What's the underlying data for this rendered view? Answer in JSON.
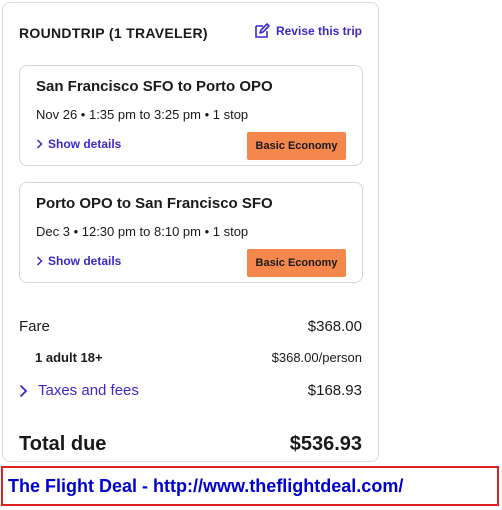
{
  "summary": {
    "title": "ROUNDTRIP (1 TRAVELER)",
    "revise_label": "Revise this trip"
  },
  "flights": [
    {
      "route": "San Francisco SFO to Porto OPO",
      "times": "Nov 26 • 1:35 pm to 3:25 pm • 1 stop",
      "details_label": "Show details",
      "fare_class": "Basic Economy"
    },
    {
      "route": "Porto OPO to San Francisco SFO",
      "times": "Dec 3 • 12:30 pm to 8:10 pm • 1 stop",
      "details_label": "Show details",
      "fare_class": "Basic Economy"
    }
  ],
  "pricing": {
    "fare_label": "Fare",
    "fare_value": "$368.00",
    "adult_label": "1 adult 18+",
    "adult_value": "$368.00/person",
    "taxes_label": "Taxes and fees",
    "taxes_value": "$168.93",
    "total_label": "Total due",
    "total_value": "$536.93"
  },
  "footer": {
    "text": "The Flight Deal - http://www.theflightdeal.com/"
  },
  "colors": {
    "link": "#3b29c8",
    "badge": "#f4874b",
    "footer_border": "#e02020",
    "footer_text": "#0000cc"
  }
}
